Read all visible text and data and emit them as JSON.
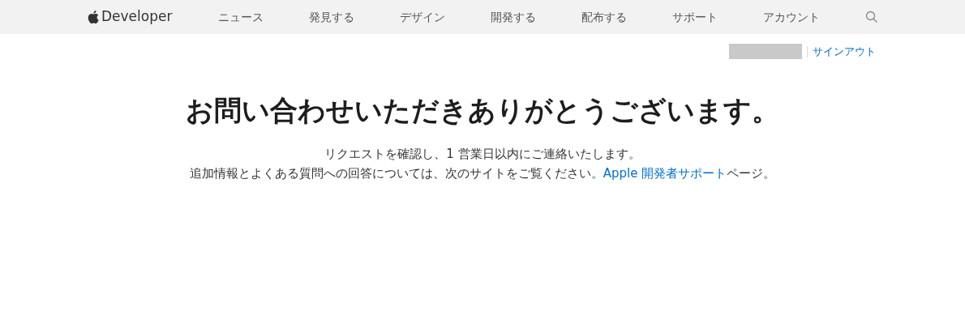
{
  "nav": {
    "brand": "Developer",
    "items": [
      "ニュース",
      "発見する",
      "デザイン",
      "開発する",
      "配布する",
      "サポート",
      "アカウント"
    ]
  },
  "account": {
    "sign_out": "サインアウト"
  },
  "heading": "お問い合わせいただきありがとうございます。",
  "message": {
    "line_1": "リクエストを確認し、1 営業日以内にご連絡いたします。",
    "line_2": "追加情報とよくある質問への回答については、次のサイトをご覧ください。",
    "link": "Apple 開発者サポート",
    "after_link": "ページ。"
  }
}
